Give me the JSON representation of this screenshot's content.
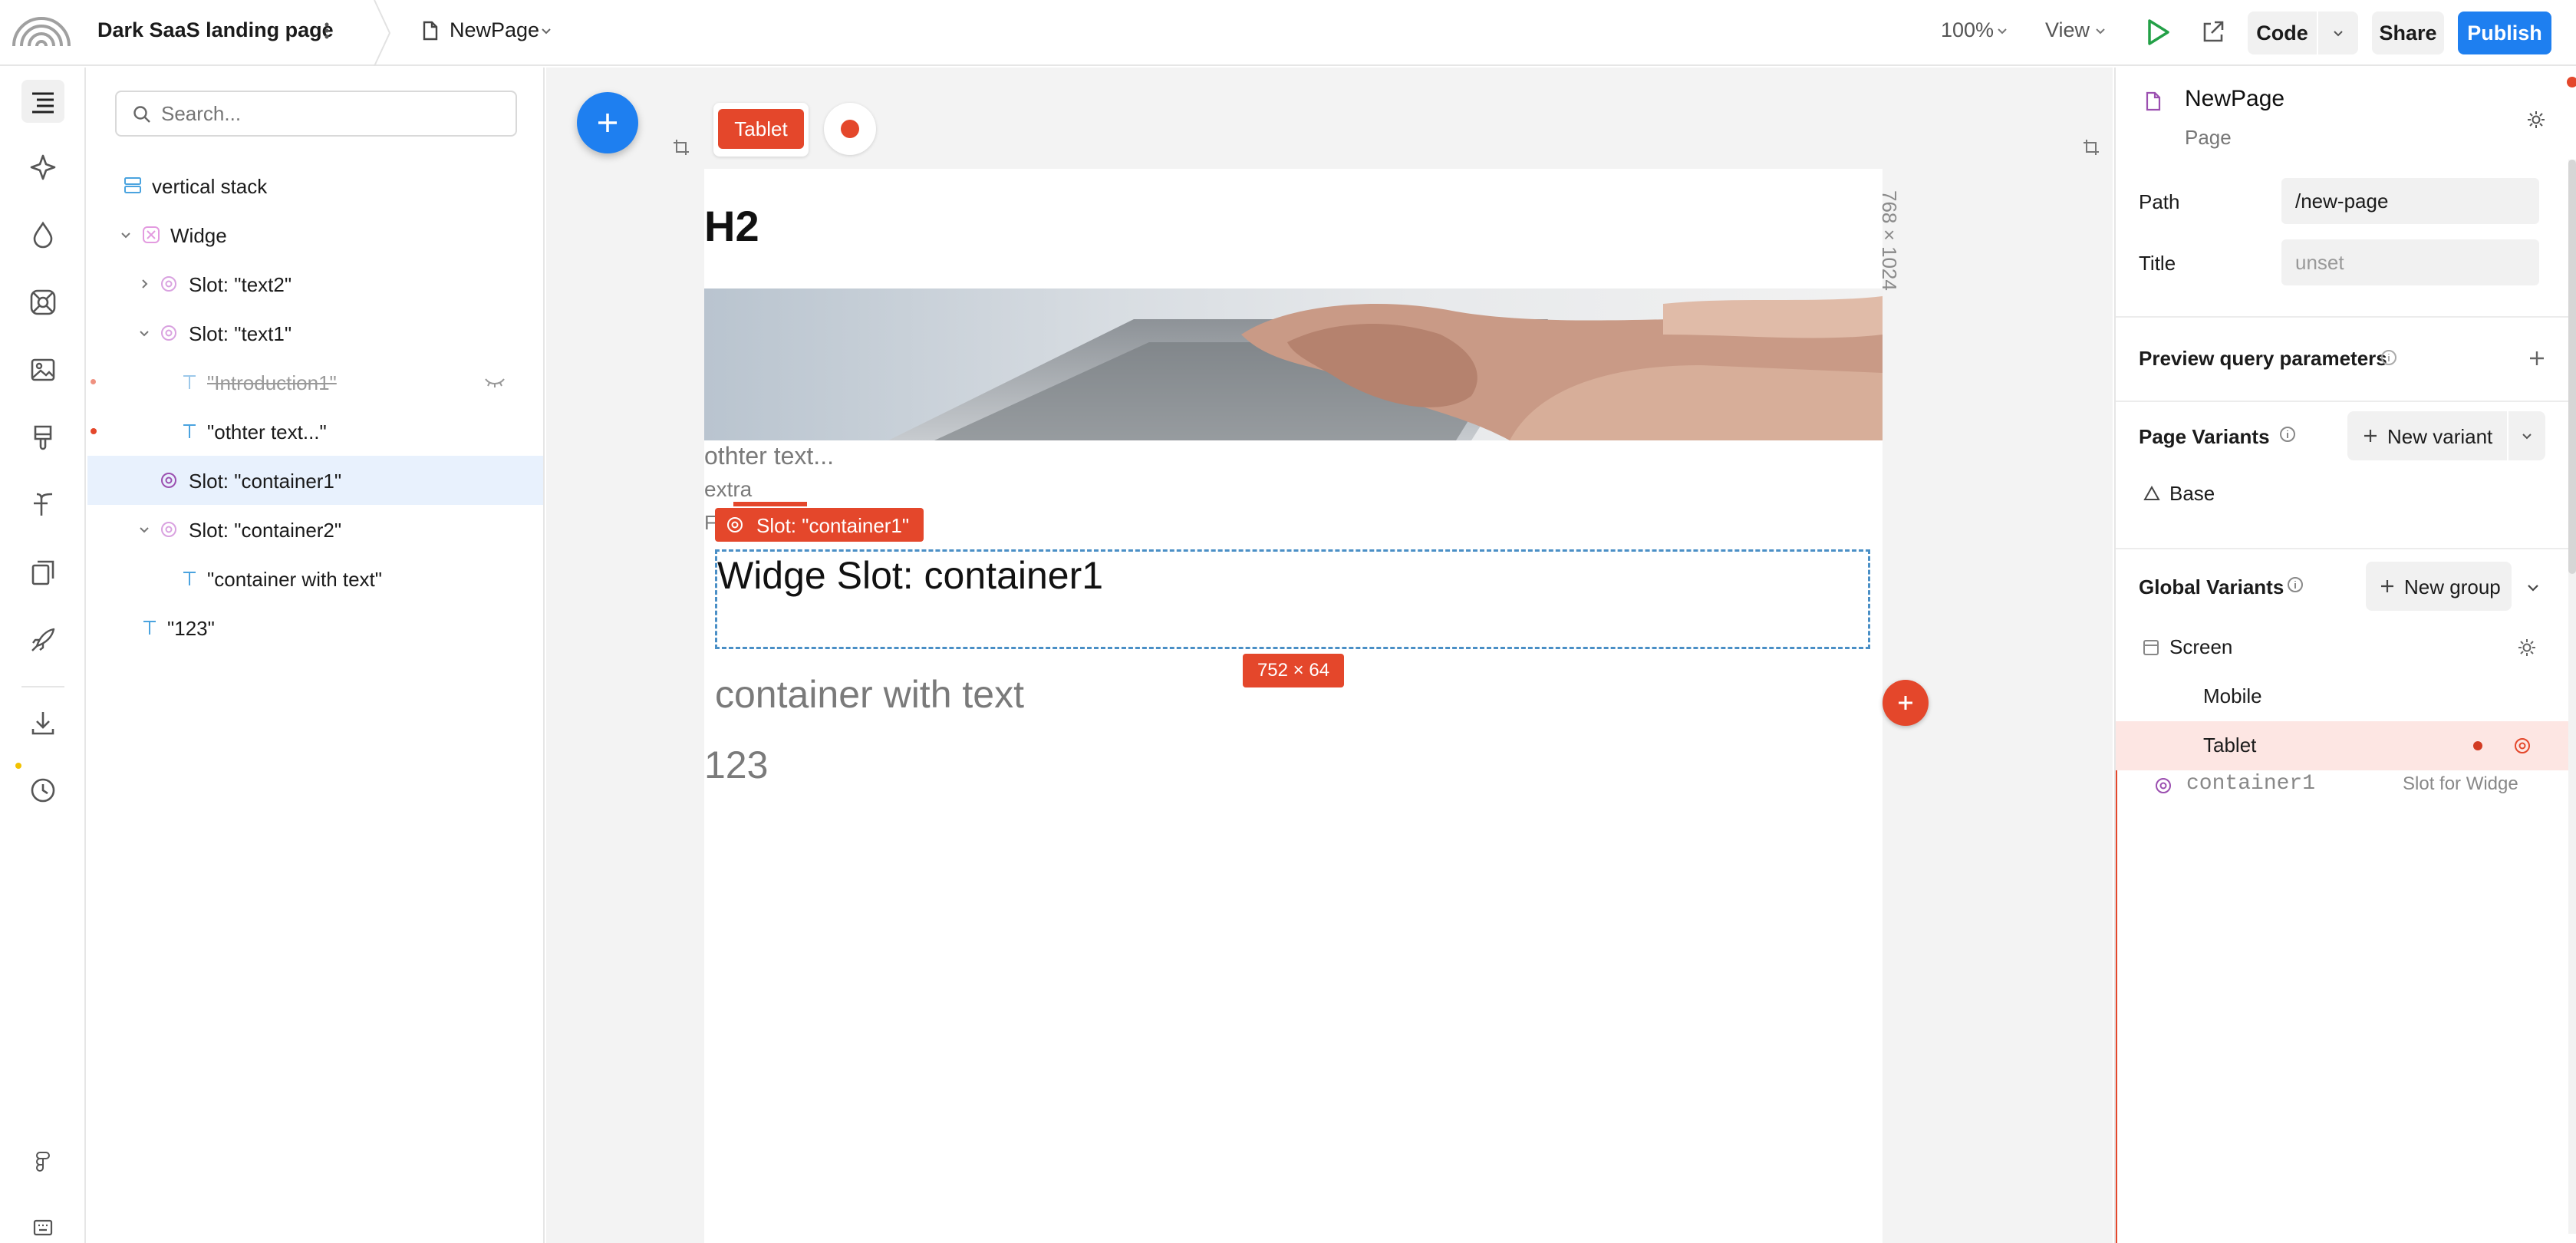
{
  "topbar": {
    "project_name": "Dark SaaS landing page",
    "page_name": "NewPage",
    "zoom": "100%",
    "view_label": "View",
    "code_label": "Code",
    "share_label": "Share",
    "publish_label": "Publish"
  },
  "layers": {
    "search_placeholder": "Search...",
    "items": [
      {
        "label": "vertical stack"
      },
      {
        "label": "Widge"
      },
      {
        "label": "Slot: \"text2\""
      },
      {
        "label": "Slot: \"text1\""
      },
      {
        "label": "\"Introduction1\""
      },
      {
        "label": "\"othter text...\""
      },
      {
        "label": "Slot: \"container1\""
      },
      {
        "label": "Slot: \"container2\""
      },
      {
        "label": "\"container with text\""
      },
      {
        "label": "\"123\""
      }
    ]
  },
  "canvas": {
    "breakpoint_badge": "Tablet",
    "size_label": "768 × 1024",
    "heading": "H2",
    "text_other": "othter text...",
    "text_extra": "extra",
    "text_cut": "F",
    "slot_tag": "Slot: \"container1\"",
    "slot_text": "Widge Slot: container1",
    "dimension_badge": "752 × 64",
    "container_text": "container with text",
    "number_text": "123"
  },
  "panel": {
    "page_title": "NewPage",
    "page_subtitle": "Page",
    "path_label": "Path",
    "path_value": "/new-page",
    "title_label": "Title",
    "title_placeholder": "unset",
    "preview_query_label": "Preview query parameters",
    "page_variants_label": "Page Variants",
    "new_variant_label": "New variant",
    "base_label": "Base",
    "global_variants_label": "Global Variants",
    "new_group_label": "New group",
    "screen_label": "Screen",
    "mobile_label": "Mobile",
    "tablet_label": "Tablet",
    "slot_name": "container1",
    "slot_for": "Slot for Widge"
  },
  "colors": {
    "accent_blue": "#1e7ff0",
    "selection_red": "#e4472b",
    "selection_bg": "#e8f1fd",
    "variant_highlight": "#fde6e3"
  }
}
